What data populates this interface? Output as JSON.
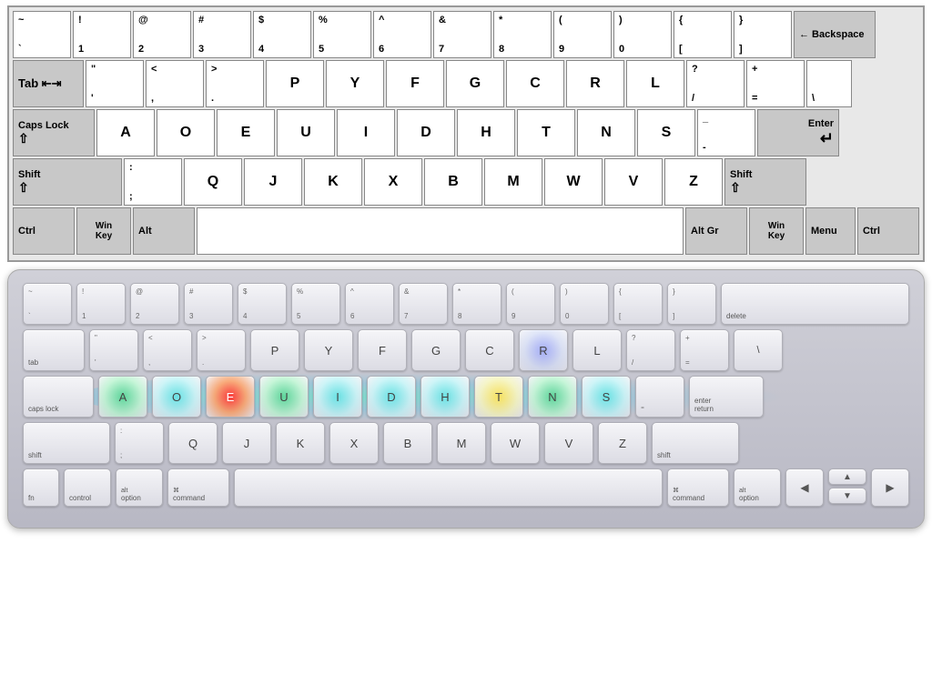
{
  "topKeyboard": {
    "rows": [
      {
        "id": "row0",
        "keys": [
          {
            "id": "tilde",
            "top": "~",
            "bot": "`",
            "w": "standard"
          },
          {
            "id": "1",
            "top": "!",
            "bot": "1",
            "w": "standard"
          },
          {
            "id": "2",
            "top": "@",
            "bot": "2",
            "w": "standard"
          },
          {
            "id": "3",
            "top": "#",
            "bot": "3",
            "w": "standard"
          },
          {
            "id": "4",
            "top": "$",
            "bot": "4",
            "w": "standard"
          },
          {
            "id": "5",
            "top": "%",
            "bot": "5",
            "w": "standard"
          },
          {
            "id": "6",
            "top": "^",
            "bot": "6",
            "w": "standard"
          },
          {
            "id": "7",
            "top": "&",
            "bot": "7",
            "w": "standard"
          },
          {
            "id": "8",
            "top": "*",
            "bot": "8",
            "w": "standard"
          },
          {
            "id": "9",
            "top": "(",
            "bot": "9",
            "w": "standard"
          },
          {
            "id": "0",
            "top": ")",
            "bot": "0",
            "w": "standard"
          },
          {
            "id": "lbracket",
            "top": "{",
            "bot": "[",
            "w": "standard"
          },
          {
            "id": "rbracket",
            "top": "}",
            "bot": "]",
            "w": "standard"
          },
          {
            "id": "backspace",
            "label": "Backspace",
            "w": "backspace"
          }
        ]
      },
      {
        "id": "row1",
        "keys": [
          {
            "id": "tab",
            "label": "Tab",
            "w": "tab"
          },
          {
            "id": "quote",
            "top": "\"",
            "bot": "'",
            "w": "standard"
          },
          {
            "id": "comma",
            "top": "<",
            "bot": ",",
            "w": "standard"
          },
          {
            "id": "dot",
            "top": ">",
            "bot": ".",
            "w": "standard"
          },
          {
            "id": "P",
            "single": "P",
            "w": "standard"
          },
          {
            "id": "Y",
            "single": "Y",
            "w": "standard"
          },
          {
            "id": "F",
            "single": "F",
            "w": "standard"
          },
          {
            "id": "G",
            "single": "G",
            "w": "standard"
          },
          {
            "id": "C",
            "single": "C",
            "w": "standard"
          },
          {
            "id": "R",
            "single": "R",
            "w": "standard"
          },
          {
            "id": "L",
            "single": "L",
            "w": "standard"
          },
          {
            "id": "slash",
            "top": "?",
            "bot": "/",
            "w": "standard"
          },
          {
            "id": "equals",
            "top": "+",
            "bot": "=",
            "w": "standard"
          },
          {
            "id": "backslash",
            "top": "",
            "bot": "\\",
            "w": "standard"
          }
        ]
      },
      {
        "id": "row2",
        "keys": [
          {
            "id": "capslock",
            "label": "Caps Lock",
            "w": "capslock"
          },
          {
            "id": "A",
            "single": "A",
            "w": "standard"
          },
          {
            "id": "O",
            "single": "O",
            "w": "standard"
          },
          {
            "id": "E",
            "single": "E",
            "w": "standard"
          },
          {
            "id": "U",
            "single": "U",
            "w": "standard"
          },
          {
            "id": "I",
            "single": "I",
            "w": "standard"
          },
          {
            "id": "D",
            "single": "D",
            "w": "standard"
          },
          {
            "id": "H",
            "single": "H",
            "w": "standard"
          },
          {
            "id": "T",
            "single": "T",
            "w": "standard"
          },
          {
            "id": "N",
            "single": "N",
            "w": "standard"
          },
          {
            "id": "S",
            "single": "S",
            "w": "standard"
          },
          {
            "id": "minus",
            "top": "_",
            "bot": "-",
            "w": "standard"
          },
          {
            "id": "enter",
            "label": "Enter",
            "w": "enter"
          }
        ]
      },
      {
        "id": "row3",
        "keys": [
          {
            "id": "shift_l",
            "label": "Shift",
            "w": "shift_l"
          },
          {
            "id": "semicolon",
            "top": ":",
            "bot": ";",
            "w": "standard"
          },
          {
            "id": "Q",
            "single": "Q",
            "w": "standard"
          },
          {
            "id": "J",
            "single": "J",
            "w": "standard"
          },
          {
            "id": "K",
            "single": "K",
            "w": "standard"
          },
          {
            "id": "X",
            "single": "X",
            "w": "standard"
          },
          {
            "id": "B",
            "single": "B",
            "w": "standard"
          },
          {
            "id": "M",
            "single": "M",
            "w": "standard"
          },
          {
            "id": "W",
            "single": "W",
            "w": "standard"
          },
          {
            "id": "V",
            "single": "V",
            "w": "standard"
          },
          {
            "id": "Z",
            "single": "Z",
            "w": "standard"
          },
          {
            "id": "shift_r",
            "label": "Shift",
            "w": "shift_r"
          }
        ]
      },
      {
        "id": "row4",
        "keys": [
          {
            "id": "ctrl_l",
            "label": "Ctrl",
            "w": "ctrl"
          },
          {
            "id": "winkey_l",
            "label": "Win Key",
            "w": "win"
          },
          {
            "id": "alt_l",
            "label": "Alt",
            "w": "alt"
          },
          {
            "id": "space",
            "label": "",
            "w": "space"
          },
          {
            "id": "altgr",
            "label": "Alt Gr",
            "w": "altgr"
          },
          {
            "id": "winkey_r",
            "label": "Win Key",
            "w": "win"
          },
          {
            "id": "menu",
            "label": "Menu",
            "w": "menu"
          },
          {
            "id": "ctrl_r",
            "label": "Ctrl",
            "w": "ctrl"
          }
        ]
      }
    ]
  },
  "bottomKeyboard": {
    "rows": [
      {
        "id": "mrow0",
        "keys": [
          {
            "id": "m_tilde",
            "top": "~",
            "bot": "`"
          },
          {
            "id": "m_1",
            "top": "!",
            "bot": "1"
          },
          {
            "id": "m_2",
            "top": "@",
            "bot": "2"
          },
          {
            "id": "m_3",
            "top": "#",
            "bot": "3"
          },
          {
            "id": "m_4",
            "top": "$",
            "bot": "4"
          },
          {
            "id": "m_5",
            "top": "%",
            "bot": "5"
          },
          {
            "id": "m_6",
            "top": "^",
            "bot": "6"
          },
          {
            "id": "m_7",
            "top": "&",
            "bot": "7"
          },
          {
            "id": "m_8",
            "top": "*",
            "bot": "8"
          },
          {
            "id": "m_9",
            "top": "(",
            "bot": "9"
          },
          {
            "id": "m_0",
            "top": ")",
            "bot": "0"
          },
          {
            "id": "m_lbr",
            "top": "{",
            "bot": "["
          },
          {
            "id": "m_rbr",
            "top": "}",
            "bot": "]"
          },
          {
            "id": "m_delete",
            "label": "delete"
          }
        ]
      },
      {
        "id": "mrow1",
        "keys": [
          {
            "id": "m_tab",
            "label": "tab"
          },
          {
            "id": "m_quote",
            "top": "\"",
            "bot": "'"
          },
          {
            "id": "m_comma",
            "top": "<",
            "bot": ","
          },
          {
            "id": "m_dot",
            "top": ">",
            "bot": "."
          },
          {
            "id": "m_P",
            "single": "P"
          },
          {
            "id": "m_Y",
            "single": "Y"
          },
          {
            "id": "m_F",
            "single": "F"
          },
          {
            "id": "m_G",
            "single": "G"
          },
          {
            "id": "m_C",
            "single": "C"
          },
          {
            "id": "m_R",
            "single": "R",
            "heat": "blue"
          },
          {
            "id": "m_L",
            "single": "L"
          },
          {
            "id": "m_slash",
            "top": "?",
            "bot": "/"
          },
          {
            "id": "m_equals",
            "top": "+",
            "bot": "="
          },
          {
            "id": "m_backslash",
            "single": "\\"
          }
        ]
      },
      {
        "id": "mrow2",
        "keys": [
          {
            "id": "m_capslock",
            "label": "caps lock"
          },
          {
            "id": "m_A",
            "single": "A",
            "heat": "green"
          },
          {
            "id": "m_O",
            "single": "O",
            "heat": "cyan"
          },
          {
            "id": "m_E",
            "single": "E",
            "heat": "red"
          },
          {
            "id": "m_U",
            "single": "U",
            "heat": "green"
          },
          {
            "id": "m_I",
            "single": "I",
            "heat": "cyan"
          },
          {
            "id": "m_D",
            "single": "D",
            "heat": "cyan"
          },
          {
            "id": "m_H",
            "single": "H",
            "heat": "cyan"
          },
          {
            "id": "m_T",
            "single": "T",
            "heat": "yellow"
          },
          {
            "id": "m_N",
            "single": "N",
            "heat": "green"
          },
          {
            "id": "m_S",
            "single": "S",
            "heat": "cyan"
          },
          {
            "id": "m_minus",
            "top": "",
            "bot": "-"
          },
          {
            "id": "m_enter",
            "label": "enter\nreturn"
          }
        ]
      },
      {
        "id": "mrow3",
        "keys": [
          {
            "id": "m_shift_l",
            "label": "shift"
          },
          {
            "id": "m_semicolon",
            "top": ":",
            "bot": ";"
          },
          {
            "id": "m_Q",
            "single": "Q"
          },
          {
            "id": "m_J",
            "single": "J"
          },
          {
            "id": "m_K",
            "single": "K"
          },
          {
            "id": "m_X",
            "single": "X"
          },
          {
            "id": "m_B",
            "single": "B"
          },
          {
            "id": "m_M",
            "single": "M"
          },
          {
            "id": "m_W",
            "single": "W"
          },
          {
            "id": "m_V",
            "single": "V"
          },
          {
            "id": "m_Z",
            "single": "Z"
          },
          {
            "id": "m_shift_r",
            "label": "shift"
          }
        ]
      },
      {
        "id": "mrow4",
        "keys": [
          {
            "id": "m_fn",
            "label": "fn"
          },
          {
            "id": "m_control",
            "label": "control"
          },
          {
            "id": "m_option_l",
            "label": "alt\noption"
          },
          {
            "id": "m_command_l",
            "label": "⌘\ncommand"
          },
          {
            "id": "m_space",
            "label": ""
          },
          {
            "id": "m_command_r",
            "label": "⌘\ncommand"
          },
          {
            "id": "m_option_r",
            "label": "alt\noption"
          },
          {
            "id": "m_arr_left",
            "label": "◀"
          },
          {
            "id": "m_arr_up",
            "label": "▲"
          },
          {
            "id": "m_arr_down",
            "label": "▼"
          },
          {
            "id": "m_arr_right",
            "label": "▶"
          }
        ]
      }
    ]
  }
}
